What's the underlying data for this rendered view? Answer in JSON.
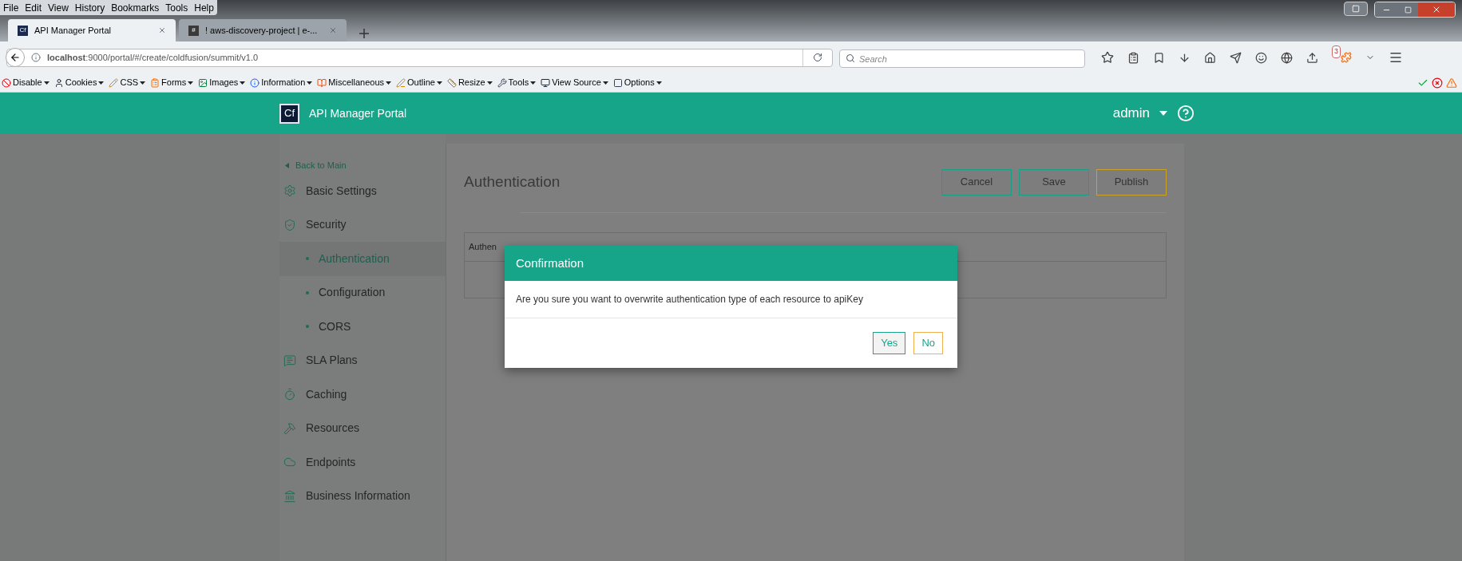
{
  "browser": {
    "menu": [
      "File",
      "Edit",
      "View",
      "History",
      "Bookmarks",
      "Tools",
      "Help"
    ],
    "tabs": [
      {
        "title": "API Manager Portal",
        "favicon": "Cf",
        "selected": true
      },
      {
        "title": "! aws-discovery-project | e-...",
        "favicon": "#",
        "selected": false
      }
    ],
    "address": "**localhost**:9000/portal/#/create/coldfusion/summit/v1.0",
    "search": {
      "placeholder": "Search"
    },
    "notification_badge": "3",
    "addon_toolbar": [
      "Disable",
      "Cookies",
      "CSS",
      "Forms",
      "Images",
      "Information",
      "Miscellaneous",
      "Outline",
      "Resize",
      "Tools",
      "View Source",
      "Options"
    ]
  },
  "header": {
    "logo": "Cf",
    "title": "API Manager Portal",
    "user": "admin"
  },
  "sidebar": {
    "back_link": "Back to Main",
    "items": [
      {
        "label": "Basic Settings",
        "selected": false
      },
      {
        "label": "Security",
        "selected": false,
        "children": [
          {
            "label": "Authentication",
            "selected": true
          },
          {
            "label": "Configuration",
            "selected": false
          },
          {
            "label": "CORS",
            "selected": false
          }
        ]
      },
      {
        "label": "SLA Plans",
        "selected": false
      },
      {
        "label": "Caching",
        "selected": false
      },
      {
        "label": "Resources",
        "selected": false
      },
      {
        "label": "Endpoints",
        "selected": false
      },
      {
        "label": "Business Information",
        "selected": false
      }
    ]
  },
  "page": {
    "title": "Authentication",
    "buttons": [
      {
        "label": "Cancel",
        "kind": "primary"
      },
      {
        "label": "Save",
        "kind": "primary"
      },
      {
        "label": "Publish",
        "kind": "warning"
      }
    ],
    "table": {
      "header": "Authen"
    }
  },
  "dialog": {
    "title": "Confirmation",
    "message": "Are you sure you want to overwrite authentication type of each resource to apiKey",
    "buttons": [
      {
        "label": "Yes",
        "kind": "primary"
      },
      {
        "label": "No",
        "kind": "warning"
      }
    ]
  }
}
